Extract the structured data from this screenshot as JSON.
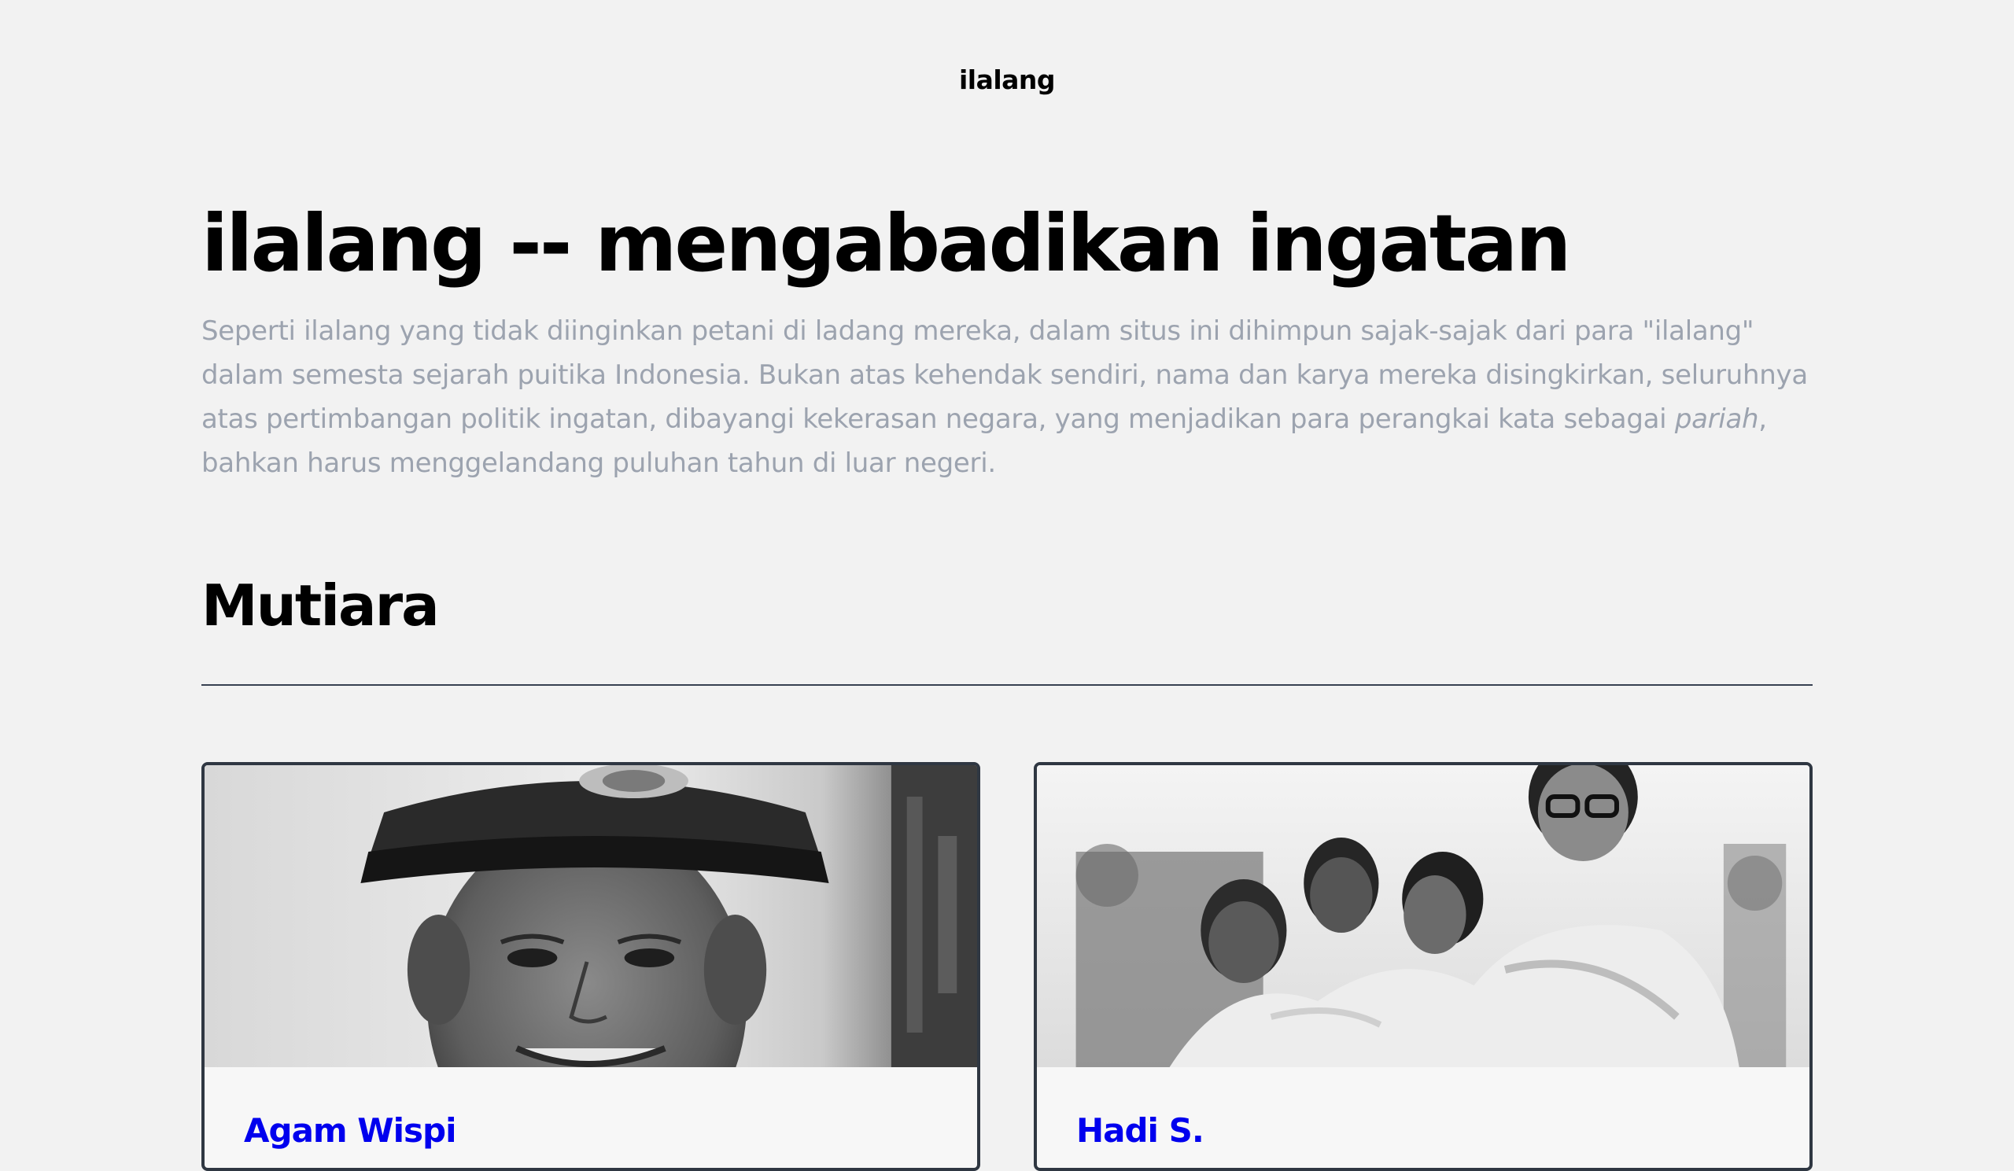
{
  "header": {
    "brand": "ilalang"
  },
  "hero": {
    "title": "ilalang -- mengabadikan ingatan",
    "description_part1": "Seperti ilalang yang tidak diinginkan petani di ladang mereka, dalam situs ini dihimpun sajak-sajak dari para \"ilalang\" dalam semesta sejarah puitika Indonesia. Bukan atas kehendak sendiri, nama dan karya mereka disingkirkan, seluruhnya atas pertimbangan politik ingatan, dibayangi kekerasan negara, yang menjadikan para perangkai kata sebagai ",
    "description_emphasis": "pariah",
    "description_part2": ", bahkan harus menggelandang puluhan tahun di luar negeri."
  },
  "section": {
    "title": "Mutiara"
  },
  "cards": [
    {
      "name": "Agam Wispi",
      "photo": "black-and-white portrait of a smiling man in a peaked cap"
    },
    {
      "name": "Hadi S.",
      "photo": "black-and-white group photo of young men sitting outdoors"
    }
  ],
  "colors": {
    "background": "#f2f2f2",
    "text": "#000000",
    "muted_text": "#9ca3af",
    "divider": "#374151",
    "card_border": "#2f3742"
  }
}
